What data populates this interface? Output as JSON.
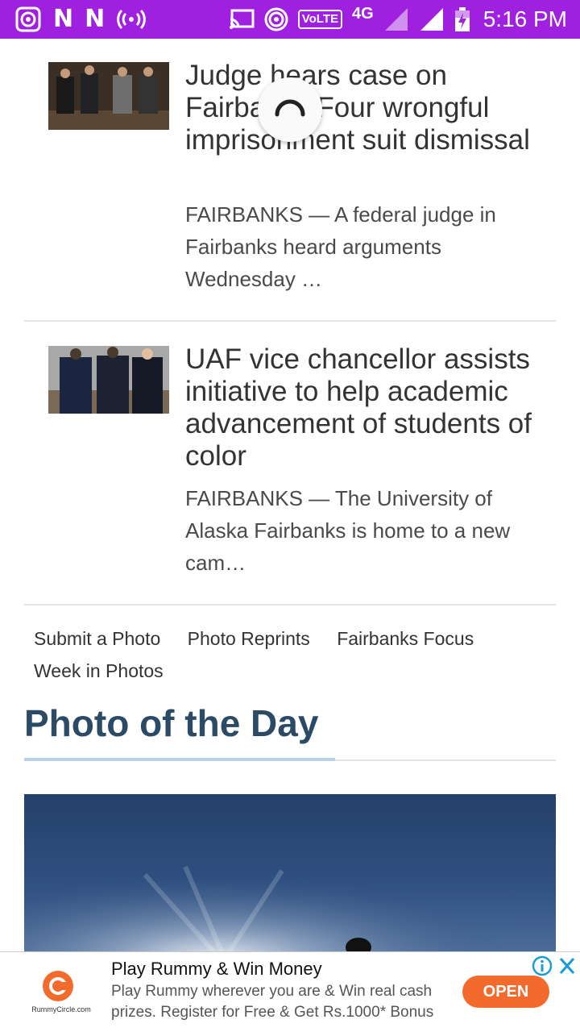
{
  "status_bar": {
    "network": "4G",
    "volte": "VoLTE",
    "time": "5:16 PM",
    "icons": [
      "radio-icon",
      "n-icon",
      "n-icon",
      "hotspot-icon",
      "cast-icon",
      "wifi-hotspot-icon",
      "volte-icon",
      "signal-icon",
      "signal-icon",
      "battery-icon"
    ]
  },
  "articles": [
    {
      "headline": "Judge hears case on Fairbanks Four wrongful imprisonment suit dismissal",
      "excerpt": "FAIRBANKS — A federal judge in Fairbanks heard arguments Wednesday …"
    },
    {
      "headline": "UAF vice chancellor assists initiative to help academic advancement of students of color",
      "excerpt": "FAIRBANKS — The University of Alaska Fairbanks is home to a new cam…"
    }
  ],
  "links": {
    "submit_photo": "Submit a Photo",
    "photo_reprints": "Photo Reprints",
    "fairbanks_focus": "Fairbanks Focus",
    "week_in_photos": "Week in Photos"
  },
  "photo_of_day": {
    "title": "Photo of the Day"
  },
  "ad": {
    "title": "Play Rummy & Win Money",
    "body": "Play Rummy wherever you are & Win real cash prizes. Register for Free & Get Rs.1000* Bonus",
    "cta": "OPEN",
    "brand": "RummyCircle.com",
    "accent": "#f26b2d"
  },
  "colors": {
    "status_bar": "#a020e0",
    "heading": "#2a4a66"
  }
}
